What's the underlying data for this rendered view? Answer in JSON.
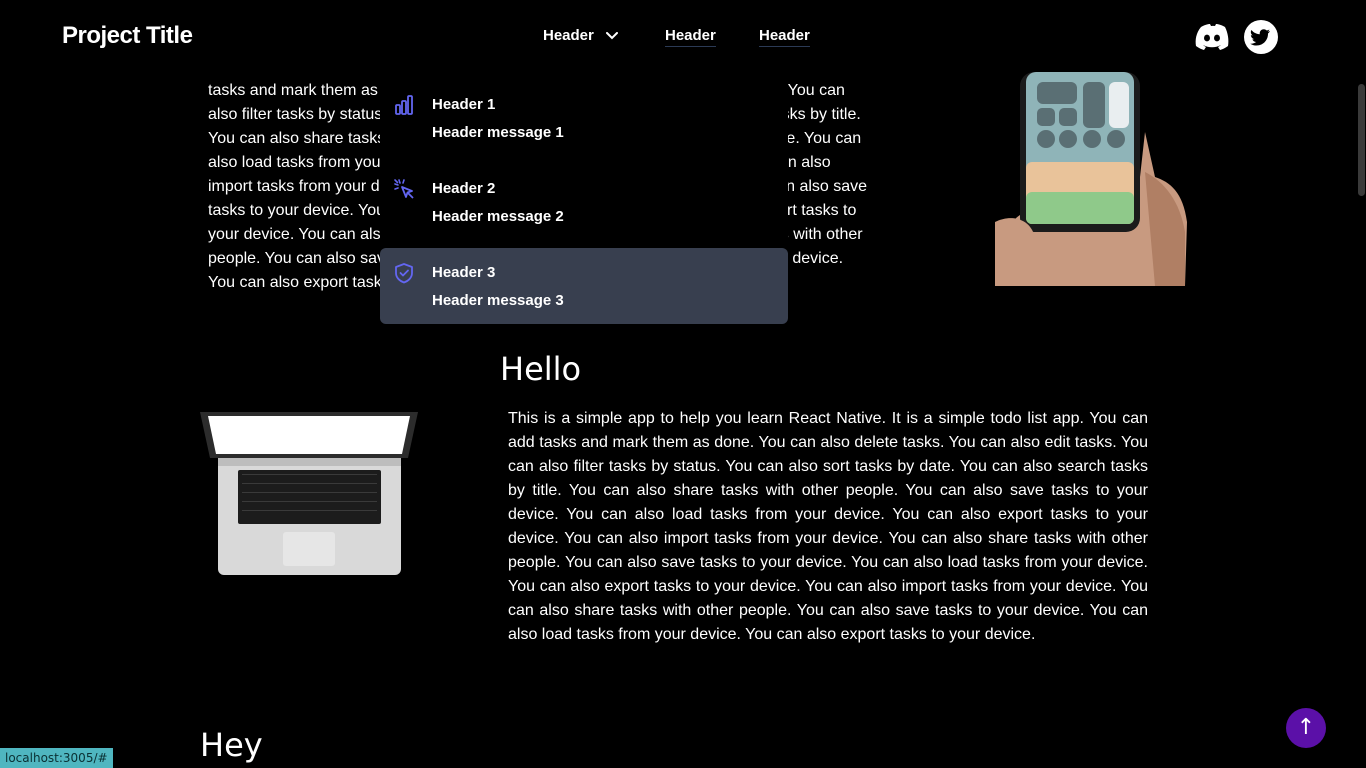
{
  "navbar": {
    "brand": "Project Title",
    "links": [
      {
        "label": "Header",
        "has_dropdown": true
      },
      {
        "label": "Header"
      },
      {
        "label": "Header"
      }
    ],
    "social": [
      "discord-icon",
      "twitter-icon"
    ]
  },
  "dropdown": {
    "items": [
      {
        "title": "Header 1",
        "message": "Header message 1",
        "icon": "bar-chart-icon"
      },
      {
        "title": "Header 2",
        "message": "Header message 2",
        "icon": "cursor-click-icon"
      },
      {
        "title": "Header 3",
        "message": "Header message 3",
        "icon": "shield-check-icon",
        "active": true
      }
    ]
  },
  "section1": {
    "lines": [
      "tasks and mark them as done. You can also delete tasks. You can also edit tasks. You can",
      "also filter tasks by status. You can also sort tasks by date. You can also search tasks by title.",
      "You can also share tasks with other people. You can also save tasks to your device. You can",
      "also load tasks from your device. You can also export tasks to your device. You can also",
      "import tasks from your device. You can also share tasks with other people. You can also save",
      "tasks to your device. You can also load tasks from your device. You can also export tasks to",
      "your device. You can also import tasks from your device. You can also share tasks with other",
      "people. You can also save tasks to your device. You can also load tasks from your device.",
      "You can also export tasks to your device."
    ]
  },
  "section2": {
    "heading": "Hello",
    "text": "This is a simple app to help you learn React Native. It is a simple todo list app. You can add tasks and mark them as done. You can also delete tasks. You can also edit tasks. You can also filter tasks by status. You can also sort tasks by date. You can also search tasks by title. You can also share tasks with other people. You can also save tasks to your device. You can also load tasks from your device. You can also export tasks to your device. You can also import tasks from your device. You can also share tasks with other people. You can also save tasks to your device. You can also load tasks from your device. You can also export tasks to your device. You can also import tasks from your device. You can also share tasks with other people. You can also save tasks to your device. You can also load tasks from your device. You can also export tasks to your device."
  },
  "section3": {
    "heading": "Hey"
  },
  "back_to_top": "↑",
  "status_url": "localhost:3005/#",
  "colors": {
    "background": "#000000",
    "accent_icon": "#6366f1",
    "active_item": "#383f4f",
    "top_button": "#5b10a8",
    "status_bar": "#4fb6c0"
  }
}
